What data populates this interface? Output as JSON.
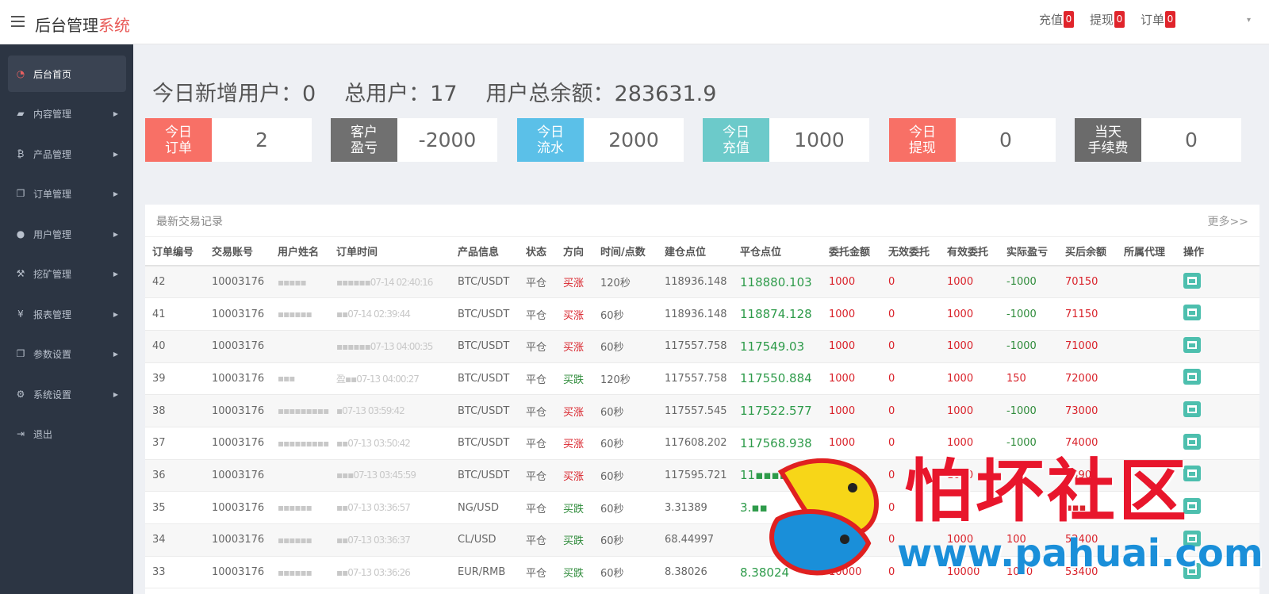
{
  "header": {
    "brand_main": "后台管理",
    "brand_accent": "系统",
    "nav": [
      {
        "label": "充值",
        "count": "0"
      },
      {
        "label": "提现",
        "count": "0"
      },
      {
        "label": "订单",
        "count": "0"
      }
    ]
  },
  "sidebar": {
    "items": [
      {
        "label": "后台首页",
        "icon": "dashboard-icon"
      },
      {
        "label": "内容管理",
        "icon": "book-icon"
      },
      {
        "label": "产品管理",
        "icon": "bitcoin-icon"
      },
      {
        "label": "订单管理",
        "icon": "files-icon"
      },
      {
        "label": "用户管理",
        "icon": "user-icon"
      },
      {
        "label": "挖矿管理",
        "icon": "pickaxe-icon"
      },
      {
        "label": "报表管理",
        "icon": "yen-icon"
      },
      {
        "label": "参数设置",
        "icon": "copy-icon"
      },
      {
        "label": "系统设置",
        "icon": "gears-icon"
      },
      {
        "label": "退出",
        "icon": "logout-icon"
      }
    ]
  },
  "summary": {
    "new_users": "今日新增用户：0",
    "total_users": "总用户：17",
    "total_balance": "用户总余额：283631.9"
  },
  "stats": [
    {
      "label1": "今日",
      "label2": "订单",
      "value": "2",
      "color": "#f87066"
    },
    {
      "label1": "客户",
      "label2": "盈亏",
      "value": "-2000",
      "color": "#707070"
    },
    {
      "label1": "今日",
      "label2": "流水",
      "value": "2000",
      "color": "#5bc0e8"
    },
    {
      "label1": "今日",
      "label2": "充值",
      "value": "1000",
      "color": "#6ccaca"
    },
    {
      "label1": "今日",
      "label2": "提现",
      "value": "0",
      "color": "#f87066"
    },
    {
      "label1": "当天",
      "label2": "手续费",
      "value": "0",
      "color": "#6b6b6b"
    }
  ],
  "table": {
    "title": "最新交易记录",
    "more": "更多>>",
    "headers": [
      "订单编号",
      "交易账号",
      "用户姓名",
      "订单时间",
      "产品信息",
      "状态",
      "方向",
      "时间/点数",
      "建仓点位",
      "平仓点位",
      "委托金额",
      "无效委托",
      "有效委托",
      "实际盈亏",
      "买后余额",
      "所属代理",
      "操作"
    ],
    "rows": [
      [
        "42",
        "10003176",
        "▪▪▪▪▪",
        "▪▪▪▪▪▪07-14 02:40:16",
        "BTC/USDT",
        "平仓",
        "买涨",
        "120秒",
        "118936.148",
        "118880.103",
        "1000",
        "0",
        "1000",
        "-1000",
        "70150",
        ""
      ],
      [
        "41",
        "10003176",
        "▪▪▪▪▪▪",
        "▪▪07-14 02:39:44",
        "BTC/USDT",
        "平仓",
        "买涨",
        "60秒",
        "118936.148",
        "118874.128",
        "1000",
        "0",
        "1000",
        "-1000",
        "71150",
        ""
      ],
      [
        "40",
        "10003176",
        "",
        "▪▪▪▪▪▪07-13 04:00:35",
        "BTC/USDT",
        "平仓",
        "买涨",
        "60秒",
        "117557.758",
        "117549.03",
        "1000",
        "0",
        "1000",
        "-1000",
        "71000",
        ""
      ],
      [
        "39",
        "10003176",
        "▪▪▪",
        "盈▪▪07-13 04:00:27",
        "BTC/USDT",
        "平仓",
        "买跌",
        "120秒",
        "117557.758",
        "117550.884",
        "1000",
        "0",
        "1000",
        "150",
        "72000",
        ""
      ],
      [
        "38",
        "10003176",
        "▪▪▪▪▪▪▪▪▪▪",
        "▪07-13 03:59:42",
        "BTC/USDT",
        "平仓",
        "买涨",
        "60秒",
        "117557.545",
        "117522.577",
        "1000",
        "0",
        "1000",
        "-1000",
        "73000",
        ""
      ],
      [
        "37",
        "10003176",
        "▪▪▪▪▪▪▪▪▪",
        "▪▪07-13 03:50:42",
        "BTC/USDT",
        "平仓",
        "买涨",
        "60秒",
        "117608.202",
        "117568.938",
        "1000",
        "0",
        "1000",
        "-1000",
        "74000",
        ""
      ],
      [
        "36",
        "10003176",
        "",
        "▪▪▪07-13 03:45:59",
        "BTC/USDT",
        "平仓",
        "买涨",
        "60秒",
        "117595.721",
        "11▪▪▪▪.1▪",
        "1000",
        "0",
        "1000",
        "",
        "73900",
        ""
      ],
      [
        "35",
        "10003176",
        "▪▪▪▪▪▪",
        "▪▪07-13 03:36:57",
        "NG/USD",
        "平仓",
        "买跌",
        "60秒",
        "3.31389",
        "3.▪▪",
        "5000",
        "0",
        "",
        "",
        "▪▪▪",
        ""
      ],
      [
        "34",
        "10003176",
        "▪▪▪▪▪▪",
        "▪▪07-13 03:36:37",
        "CL/USD",
        "平仓",
        "买跌",
        "60秒",
        "68.44997",
        "",
        "10▪",
        "0",
        "1000",
        "100",
        "52400",
        ""
      ],
      [
        "33",
        "10003176",
        "▪▪▪▪▪▪",
        "▪▪07-13 03:36:26",
        "EUR/RMB",
        "平仓",
        "买跌",
        "60秒",
        "8.38026",
        "8.38024",
        "10000",
        "0",
        "10000",
        "1000",
        "53400",
        ""
      ]
    ]
  },
  "watermark": {
    "cn": "怕坏社区",
    "url": "www.pahuai.com"
  }
}
